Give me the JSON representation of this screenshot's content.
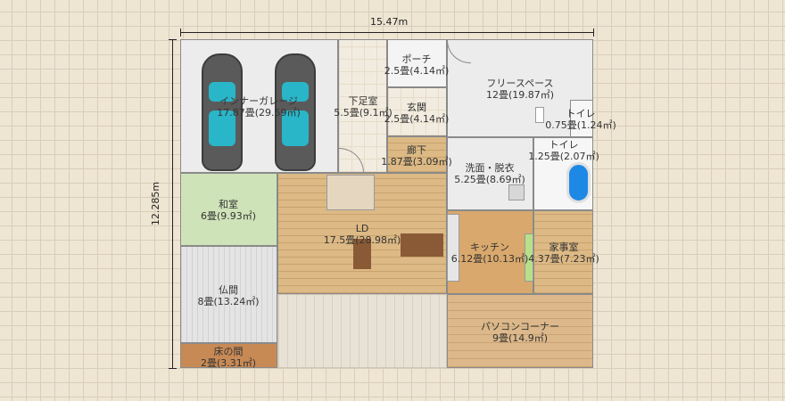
{
  "dimensions": {
    "width_label": "15.47m",
    "height_label": "12.285m"
  },
  "rooms": {
    "garage": {
      "name": "インナーガレージ",
      "area": "17.87畳(29.59㎡)"
    },
    "shoes": {
      "name": "下足室",
      "area": "5.5畳(9.1㎡)"
    },
    "porch": {
      "name": "ポーチ",
      "area": "2.5畳(4.14㎡)"
    },
    "genkan": {
      "name": "玄関",
      "area": "2.5畳(4.14㎡)"
    },
    "free": {
      "name": "フリースペース",
      "area": "12畳(19.87㎡)"
    },
    "toilet1": {
      "name": "トイレ",
      "area": "0.75畳(1.24㎡)"
    },
    "toilet2": {
      "name": "トイレ",
      "area": "1.25畳(2.07㎡)"
    },
    "hall": {
      "name": "廊下",
      "area": "1.87畳(3.09㎡)"
    },
    "wash": {
      "name": "洗面・脱衣",
      "area": "5.25畳(8.69㎡)"
    },
    "washitsu": {
      "name": "和室",
      "area": "6畳(9.93㎡)"
    },
    "ld": {
      "name": "LD",
      "area": "17.5畳(28.98㎡)"
    },
    "kitchen": {
      "name": "キッチン",
      "area": "6.12畳(10.13㎡)"
    },
    "kaji": {
      "name": "家事室",
      "area": "4.37畳(7.23㎡)"
    },
    "butsuma": {
      "name": "仏間",
      "area": "8畳(13.24㎡)"
    },
    "pc": {
      "name": "パソコンコーナー",
      "area": "9畳(14.9㎡)"
    },
    "toko": {
      "name": "床の間",
      "area": "2畳(3.31㎡)"
    }
  },
  "colors": {
    "grid": "#d9cdb8",
    "background": "#efe5d3",
    "bath": "#1e88e5",
    "car_glass": "#29b6c8"
  },
  "icons": [
    "car-icon",
    "bathtub-icon",
    "door-swing-icon",
    "stairs-icon",
    "dining-table-icon"
  ]
}
